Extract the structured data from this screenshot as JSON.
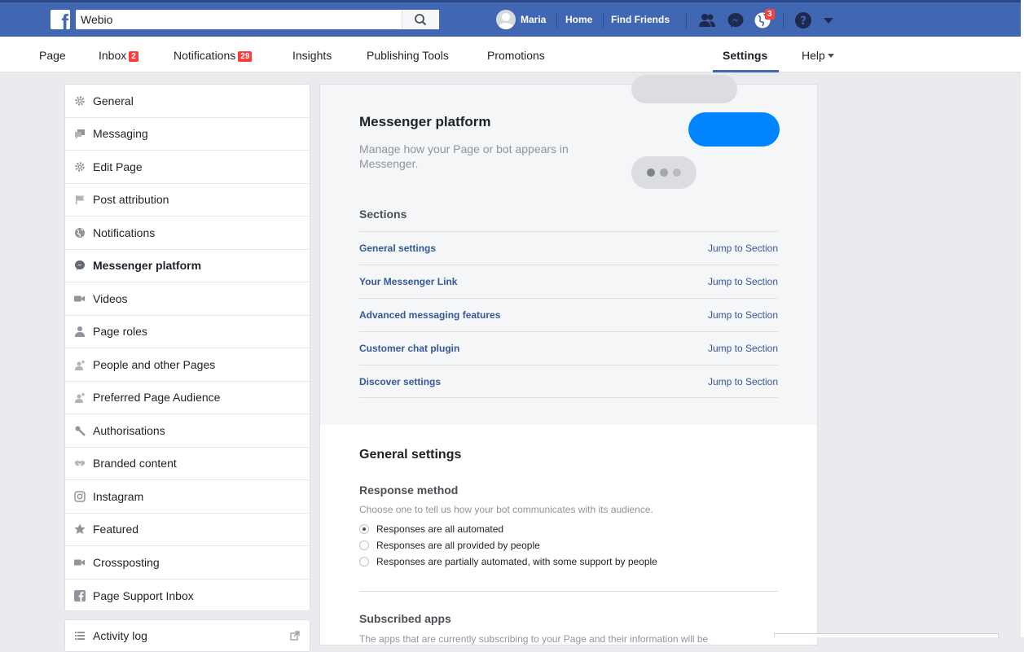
{
  "topbar": {
    "search_value": "Webio",
    "user_name": "Maria",
    "home": "Home",
    "find_friends": "Find Friends",
    "notifications_count": "3"
  },
  "tabs": [
    {
      "label": "Page"
    },
    {
      "label": "Inbox",
      "count": "2"
    },
    {
      "label": "Notifications",
      "count": "29"
    },
    {
      "label": "Insights"
    },
    {
      "label": "Publishing Tools"
    },
    {
      "label": "Promotions"
    },
    {
      "label": "Settings"
    },
    {
      "label": "Help"
    }
  ],
  "sidebar": {
    "items": [
      {
        "label": "General",
        "icon": "gear-icon"
      },
      {
        "label": "Messaging",
        "icon": "messaging-icon"
      },
      {
        "label": "Edit Page",
        "icon": "gear-icon"
      },
      {
        "label": "Post attribution",
        "icon": "flag-icon"
      },
      {
        "label": "Notifications",
        "icon": "globe-icon"
      },
      {
        "label": "Messenger platform",
        "icon": "messenger-icon"
      },
      {
        "label": "Videos",
        "icon": "video-icon"
      },
      {
        "label": "Page roles",
        "icon": "person-icon"
      },
      {
        "label": "People and other Pages",
        "icon": "person-star-icon"
      },
      {
        "label": "Preferred Page Audience",
        "icon": "person-star-icon"
      },
      {
        "label": "Authorisations",
        "icon": "wrench-icon"
      },
      {
        "label": "Branded content",
        "icon": "handshake-icon"
      },
      {
        "label": "Instagram",
        "icon": "instagram-icon"
      },
      {
        "label": "Featured",
        "icon": "star-icon"
      },
      {
        "label": "Crossposting",
        "icon": "video-icon"
      },
      {
        "label": "Page Support Inbox",
        "icon": "facebook-icon"
      }
    ],
    "activity_log": "Activity log"
  },
  "main": {
    "title": "Messenger platform",
    "description": "Manage how your Page or bot appears in Messenger.",
    "sections_title": "Sections",
    "jump_label": "Jump to Section",
    "sections": [
      {
        "name": "General settings"
      },
      {
        "name": "Your Messenger Link"
      },
      {
        "name": "Advanced messaging features"
      },
      {
        "name": "Customer chat plugin"
      },
      {
        "name": "Discover settings"
      }
    ],
    "general_settings_title": "General settings",
    "response_method_title": "Response method",
    "response_method_desc": "Choose one to tell us how your bot communicates with its audience.",
    "response_options": [
      {
        "label": "Responses are all automated",
        "checked": true
      },
      {
        "label": "Responses are all provided by people",
        "checked": false
      },
      {
        "label": "Responses are partially automated, with some support by people",
        "checked": false
      }
    ],
    "subscribed_apps_title": "Subscribed apps",
    "subscribed_apps_desc": "The apps that are currently subscribing to your Page and their information will be"
  },
  "colors": {
    "brand": "#4267b2",
    "messenger_blue": "#0084ff",
    "link": "#365899",
    "badge": "#fa3e3e"
  }
}
